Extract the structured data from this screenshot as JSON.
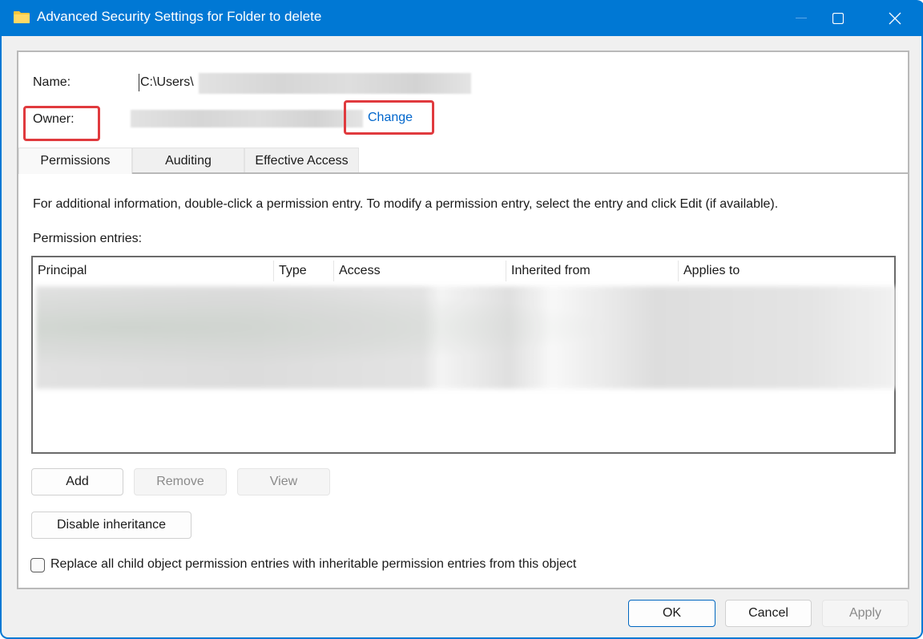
{
  "window": {
    "title": "Advanced Security Settings for Folder to delete",
    "icon": "folder-icon",
    "controls": [
      "minimize-icon",
      "maximize-icon",
      "close-icon"
    ],
    "accent_color": "#0078d4"
  },
  "header": {
    "name_label": "Name:",
    "name_value": "C:\\Users\\",
    "owner_label": "Owner:",
    "owner_value": "",
    "change_link": "Change",
    "highlight_color": "#e03a3e"
  },
  "tabs": [
    {
      "label": "Permissions",
      "active": true
    },
    {
      "label": "Auditing",
      "active": false
    },
    {
      "label": "Effective Access",
      "active": false
    }
  ],
  "permissions": {
    "info_text": "For additional information, double-click a permission entry. To modify a permission entry, select the entry and click Edit (if available).",
    "entries_label": "Permission entries:",
    "columns": [
      "Principal",
      "Type",
      "Access",
      "Inherited from",
      "Applies to"
    ],
    "rows_note": "blurred"
  },
  "buttons": {
    "add": "Add",
    "remove": "Remove",
    "view": "View",
    "disable_inheritance": "Disable inheritance"
  },
  "checkbox": {
    "label": "Replace all child object permission entries with inheritable permission entries from this object",
    "checked": false
  },
  "footer": {
    "ok": "OK",
    "cancel": "Cancel",
    "apply": "Apply"
  }
}
